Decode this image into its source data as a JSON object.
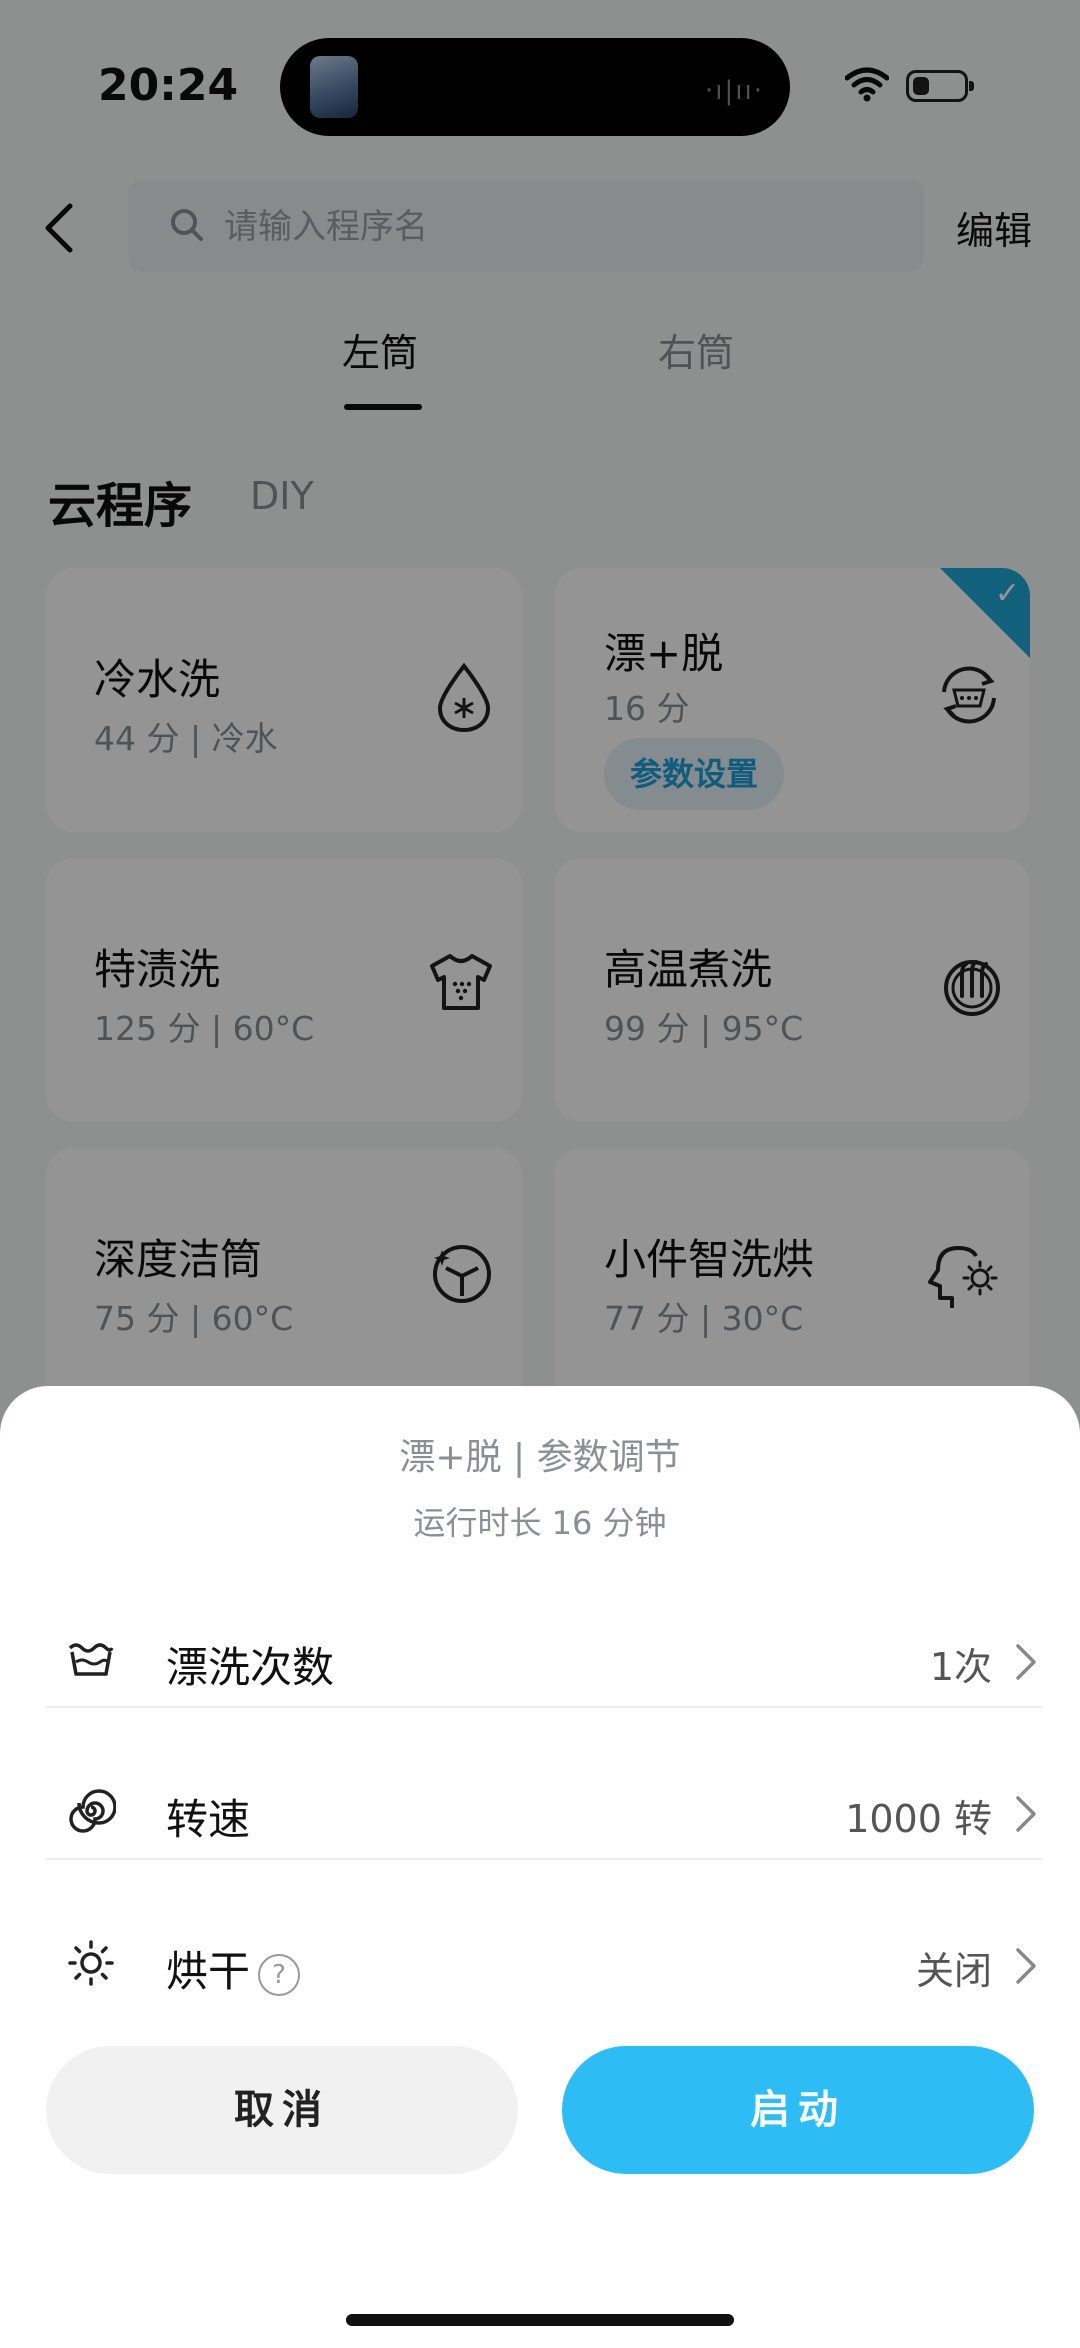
{
  "status_bar": {
    "time": "20:24"
  },
  "header": {
    "search_placeholder": "请输入程序名",
    "edit_label": "编辑"
  },
  "tabs": [
    {
      "label": "左筒",
      "active": true
    },
    {
      "label": "右筒",
      "active": false
    }
  ],
  "section": {
    "title": "云程序",
    "alt": "DIY"
  },
  "programs": [
    {
      "name": "冷水洗",
      "detail": "44 分 | 冷水",
      "icon": "water-drop-snowflake-icon"
    },
    {
      "name": "漂+脱",
      "detail": "16 分",
      "icon": "rinse-spin-icon",
      "selected": true,
      "param_button": "参数设置"
    },
    {
      "name": "特渍洗",
      "detail": "125 分 | 60°C",
      "icon": "tshirt-stain-icon"
    },
    {
      "name": "高温煮洗",
      "detail": "99 分 | 95°C",
      "icon": "high-temp-boil-icon"
    },
    {
      "name": "深度洁筒",
      "detail": "75 分 | 60°C",
      "icon": "drum-clean-icon"
    },
    {
      "name": "小件智洗烘",
      "detail": "77 分 | 30°C",
      "icon": "smart-wash-dry-icon"
    }
  ],
  "sheet": {
    "title": "漂+脱 | 参数调节",
    "subtitle": "运行时长  16 分钟",
    "rows": [
      {
        "label": "漂洗次数",
        "value": "1次",
        "icon": "rinse-basin-icon"
      },
      {
        "label": "转速",
        "value": "1000 转",
        "icon": "spiral-spin-icon"
      },
      {
        "label": "烘干",
        "value": "关闭",
        "icon": "sun-dry-icon",
        "help": "?"
      }
    ],
    "cancel_label": "取消",
    "start_label": "启动"
  },
  "colors": {
    "accent": "#2dbdf4",
    "selected_corner": "#1ea8d8",
    "param_text": "#1e9fd6"
  }
}
